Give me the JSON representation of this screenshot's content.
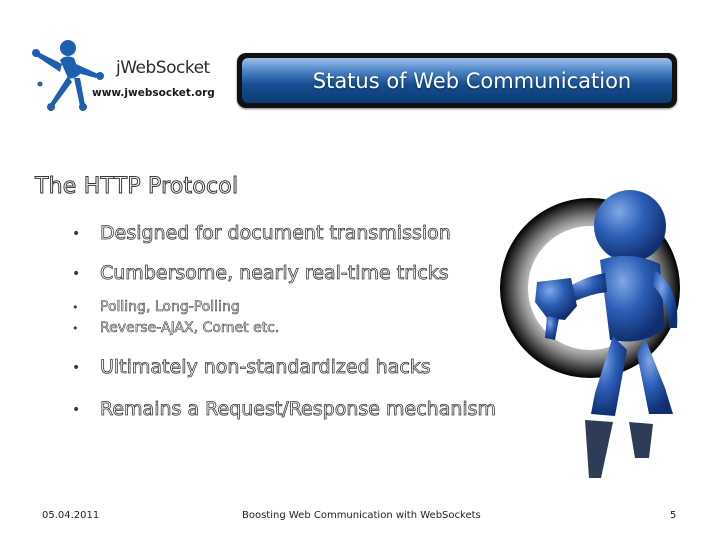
{
  "logo": {
    "brand": "jWebSocket",
    "url": "www.jwebsocket.org"
  },
  "slide": {
    "title": "Status of Web Communication",
    "heading": "The HTTP Protocol",
    "bullets": [
      "Designed for document transmission",
      "Cumbersome, nearly real-time tricks",
      "Polling, Long-Polling",
      "Reverse-AJAX, Comet etc.",
      "Ultimately non-standardized hacks",
      "Remains a Request/Response mechanism"
    ],
    "bullet_glyph": "•"
  },
  "footer": {
    "date": "05.04.2011",
    "title": "Boosting Web Communication with WebSockets",
    "page": "5"
  },
  "colors": {
    "title_bar_top": "#9fc1e8",
    "title_bar_bottom": "#0c3a73",
    "figure_blue": "#1e4fa8"
  }
}
